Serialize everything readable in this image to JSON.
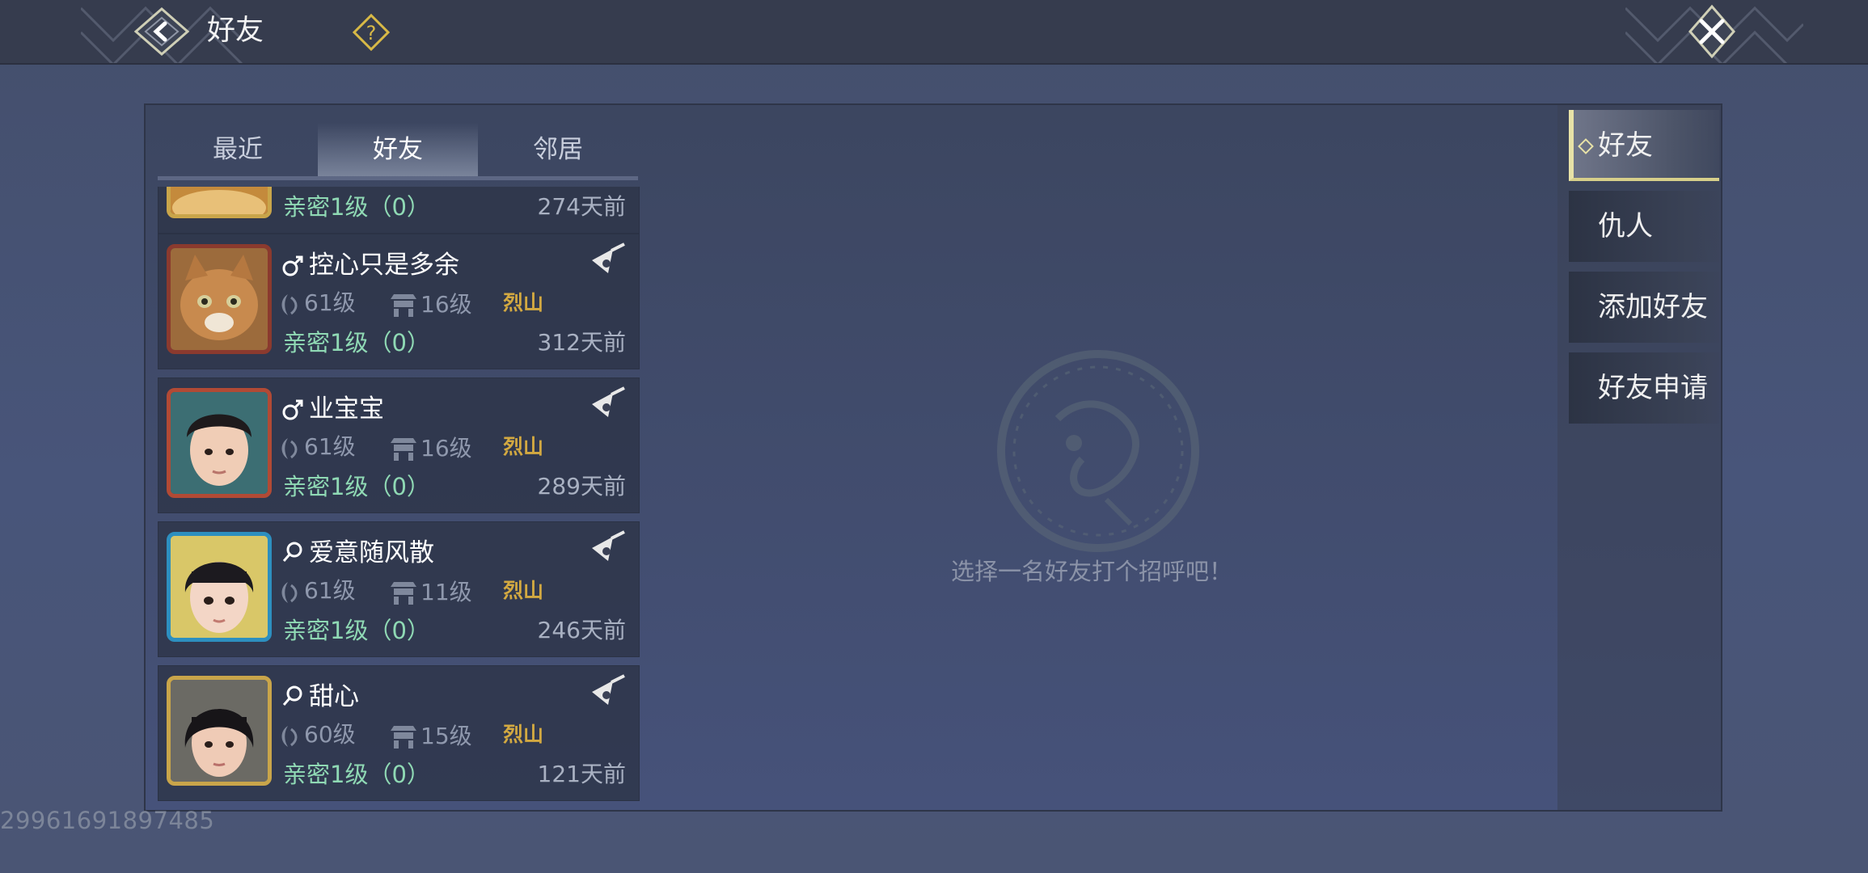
{
  "header": {
    "title": "好友"
  },
  "tabs": [
    {
      "label": "最近",
      "active": false
    },
    {
      "label": "好友",
      "active": true
    },
    {
      "label": "邻居",
      "active": false
    }
  ],
  "friends": [
    {
      "name": "",
      "gender": "",
      "level": "",
      "house": "",
      "server": "",
      "intimacy": "亲密1级（0）",
      "last_seen": "274天前"
    },
    {
      "name": "控心只是多余",
      "gender": "male",
      "level": "61级",
      "house": "16级",
      "server": "烈山",
      "intimacy": "亲密1级（0）",
      "last_seen": "312天前"
    },
    {
      "name": "业宝宝",
      "gender": "male",
      "level": "61级",
      "house": "16级",
      "server": "烈山",
      "intimacy": "亲密1级（0）",
      "last_seen": "289天前"
    },
    {
      "name": "爱意随风散",
      "gender": "female",
      "level": "61级",
      "house": "11级",
      "server": "烈山",
      "intimacy": "亲密1级（0）",
      "last_seen": "246天前"
    },
    {
      "name": "甜心",
      "gender": "female",
      "level": "60级",
      "house": "15级",
      "server": "烈山",
      "intimacy": "亲密1级（0）",
      "last_seen": "121天前"
    }
  ],
  "empty_state": {
    "text": "选择一名好友打个招呼吧！"
  },
  "side_menu": [
    {
      "label": "好友",
      "active": true
    },
    {
      "label": "仇人",
      "active": false
    },
    {
      "label": "添加好友",
      "active": false
    },
    {
      "label": "好友申请",
      "active": false
    }
  ],
  "footer": {
    "uid": "29961691897485"
  },
  "colors": {
    "accent": "#e8e2a7",
    "intimacy": "#8fd9b4",
    "server": "#d3a941"
  }
}
